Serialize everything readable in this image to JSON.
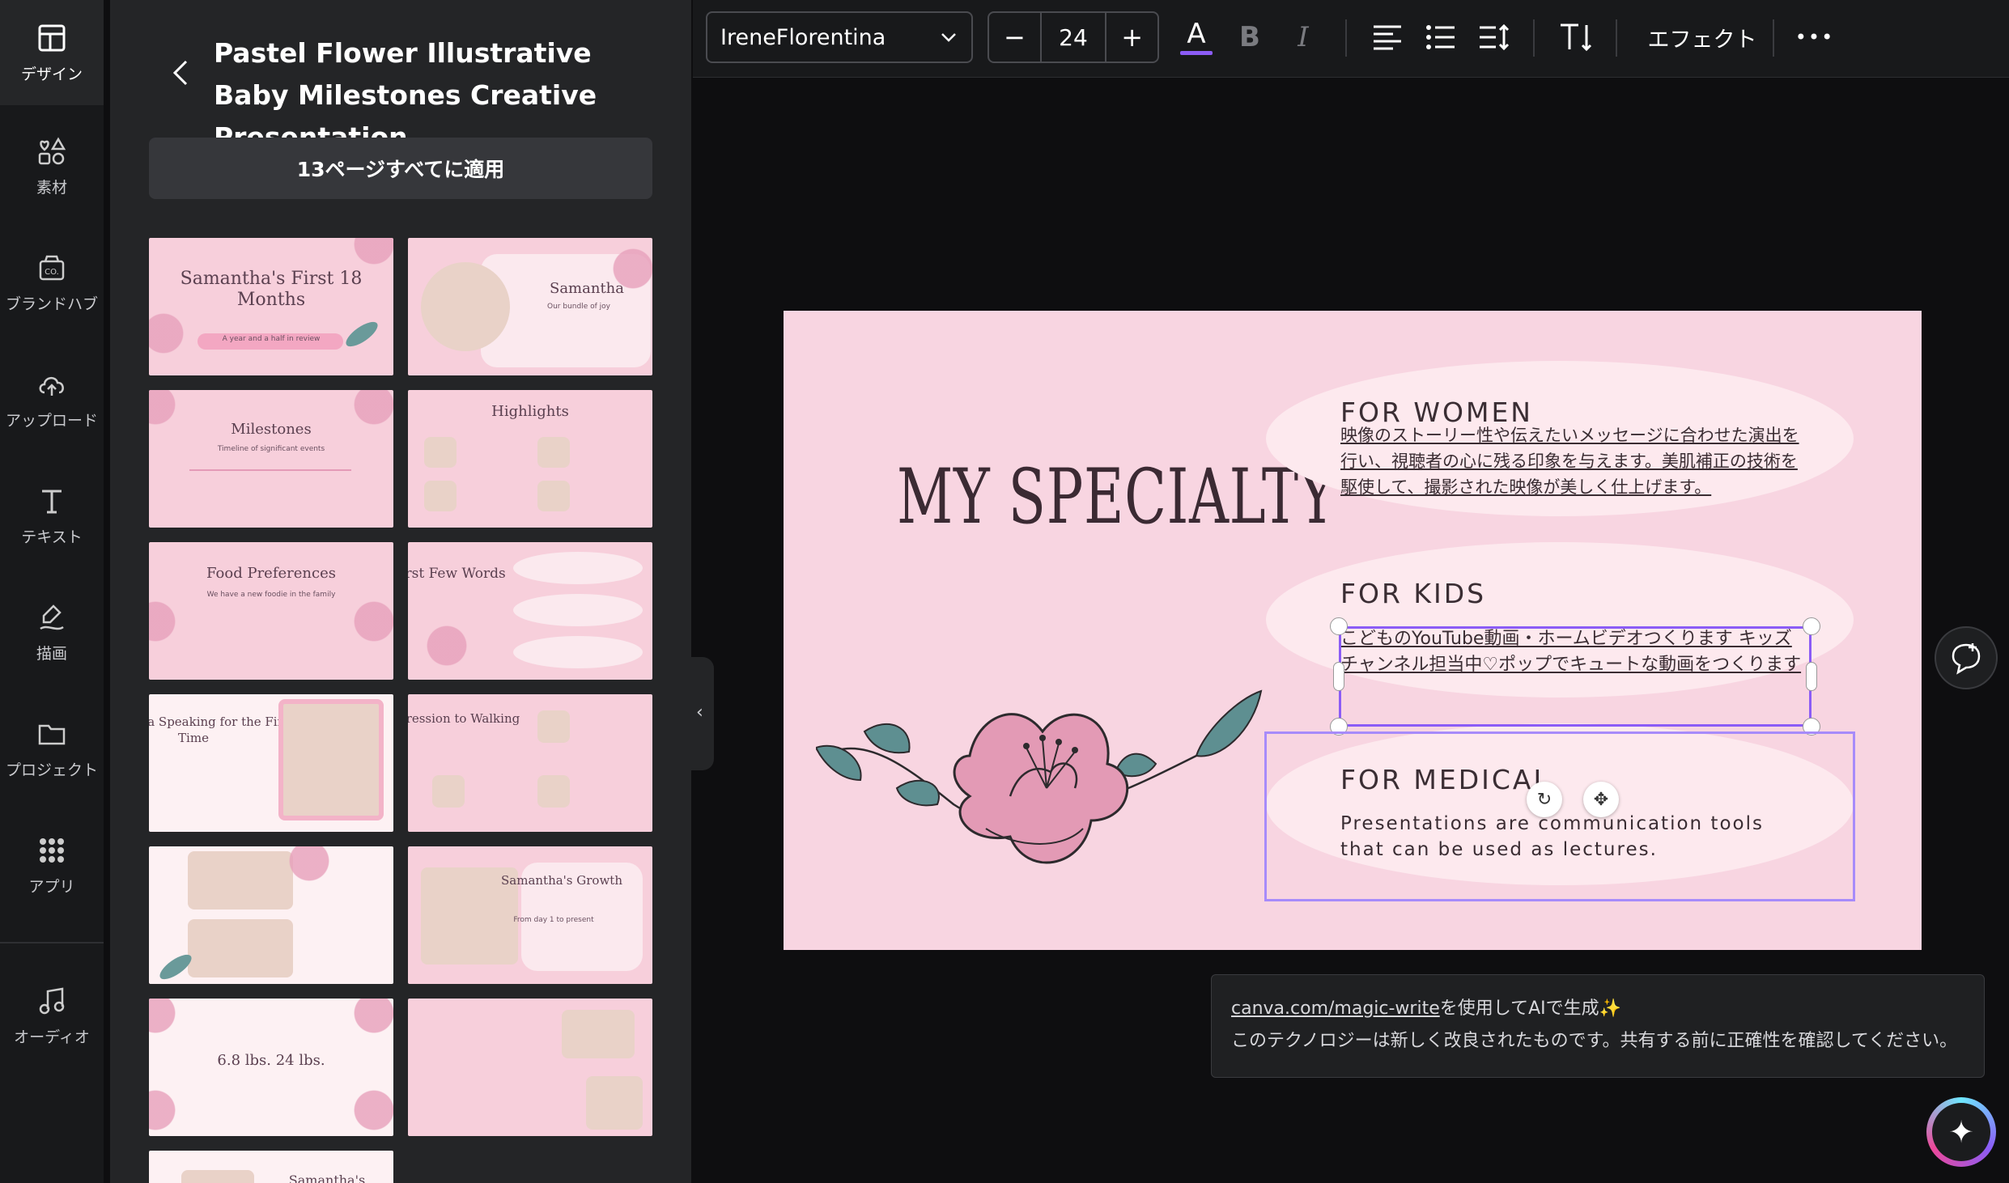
{
  "rail": {
    "items": [
      {
        "label": "デザイン",
        "icon": "layout-icon"
      },
      {
        "label": "素材",
        "icon": "shapes-icon"
      },
      {
        "label": "ブランドハブ",
        "icon": "brand-icon"
      },
      {
        "label": "アップロード",
        "icon": "cloud-upload-icon"
      },
      {
        "label": "テキスト",
        "icon": "text-icon"
      },
      {
        "label": "描画",
        "icon": "draw-icon"
      },
      {
        "label": "プロジェクト",
        "icon": "folder-icon"
      },
      {
        "label": "アプリ",
        "icon": "apps-grid-icon"
      },
      {
        "label": "オーディオ",
        "icon": "music-note-icon"
      }
    ]
  },
  "panel": {
    "title": "Pastel Flower Illustrative Baby Milestones Creative Presentation",
    "apply_label": "13ページすべてに適用",
    "thumbnails": [
      {
        "title": "Samantha's First 18 Months",
        "sub": "A year and a half in review"
      },
      {
        "title": "Samantha",
        "sub": "Our bundle of joy"
      },
      {
        "title": "Milestones",
        "sub": "Timeline of significant events"
      },
      {
        "title": "Highlights",
        "sub": ""
      },
      {
        "title": "Food Preferences",
        "sub": "We have a new foodie in the family"
      },
      {
        "title": "First Few Words",
        "sub": ""
      },
      {
        "title": "Samantha Speaking for the First Time",
        "sub": ""
      },
      {
        "title": "Progression to Walking",
        "sub": ""
      },
      {
        "title": "",
        "sub": ""
      },
      {
        "title": "Samantha's Growth",
        "sub": "From day 1 to present"
      },
      {
        "title": "6.8 lbs.   24 lbs.",
        "sub": ""
      },
      {
        "title": "",
        "sub": ""
      },
      {
        "title": "Samantha's",
        "sub": ""
      }
    ]
  },
  "toolbar": {
    "font_name": "IreneFlorentina",
    "font_size": "24",
    "minus": "−",
    "plus": "+",
    "effect_label": "エフェクト",
    "text_color_glyph": "A",
    "bold_glyph": "B",
    "italic_glyph": "I",
    "more_glyph": "•••"
  },
  "slide": {
    "title": "MY SPECIALTY",
    "cards": [
      {
        "heading": "FOR WOMEN",
        "text": "映像のストーリー性や伝えたいメッセージに合わせた演出を行い、視聴者の心に残る印象を与えます。美肌補正の技術を駆使して、撮影された映像が美しく仕上げます。"
      },
      {
        "heading": "FOR KIDS",
        "text": "こどものYouTube動画・ホームビデオつくります キッズチャンネル担当中♡ポップでキュートな動画をつくります"
      },
      {
        "heading": "FOR MEDICAL",
        "text": "Presentations are communication tools that can be used as lectures."
      }
    ]
  },
  "magic_write": {
    "link": "canva.com/magic-write",
    "line1_suffix": "を使用してAIで生成✨",
    "line2": "このテクノロジーは新しく改良されたものです。共有する前に正確性を確認してください。"
  },
  "colors": {
    "accent": "#8b5cf6",
    "slide_bg": "#f8d5e1",
    "card_bg": "#fde9ee",
    "leaf": "#5e8f91",
    "flower": "#e39ab5"
  }
}
